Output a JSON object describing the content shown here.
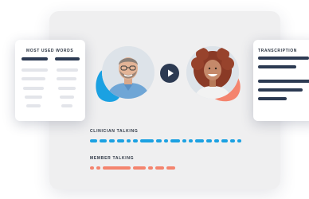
{
  "most_used_words": {
    "title": "MOST USED WORDS"
  },
  "transcription": {
    "title": "TRANSCRIPTION"
  },
  "clinician": {
    "label": "CLINICIAN TALKING",
    "color": "#1ba1e2"
  },
  "member": {
    "label": "MEMBER TALKING",
    "color": "#f4846e"
  },
  "colors": {
    "dark": "#2c3a52",
    "blue": "#1ba1e2",
    "coral": "#f4846e",
    "card_bg": "#efeff0"
  },
  "icons": {
    "play": "play-icon"
  }
}
